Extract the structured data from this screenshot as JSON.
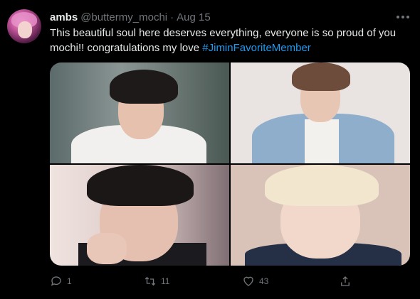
{
  "tweet": {
    "author": {
      "display_name": "ambs",
      "handle": "@buttermy_mochi",
      "separator": "·",
      "date": "Aug 15"
    },
    "text_main": "This beautiful soul here deserves everything, everyone is so proud of you mochi!! congratulations my love ",
    "hashtag": "#JiminFavoriteMember",
    "stats": {
      "replies": "1",
      "retweets": "11",
      "likes": "43"
    },
    "colors": {
      "background": "#000000",
      "text": "#e7e9ea",
      "secondary": "#71767b",
      "link": "#1d9bf0"
    }
  }
}
